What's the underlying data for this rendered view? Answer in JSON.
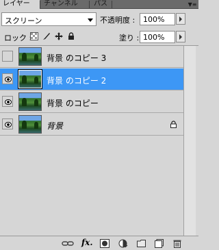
{
  "tabs": [
    {
      "label": "レイヤー",
      "active": true
    },
    {
      "label": "チャンネル",
      "active": false
    },
    {
      "label": "パス",
      "active": false
    }
  ],
  "blend": {
    "mode": "スクリーン"
  },
  "opacity": {
    "label": "不透明度 :",
    "value": "100%"
  },
  "lock": {
    "label": "ロック :"
  },
  "fill": {
    "label": "塗り :",
    "value": "100%"
  },
  "layers": [
    {
      "name": "背景 のコピー 3",
      "visible": false,
      "selected": false,
      "italic": false
    },
    {
      "name": "背景 のコピー 2",
      "visible": true,
      "selected": true,
      "italic": false
    },
    {
      "name": "背景 のコピー",
      "visible": true,
      "selected": false,
      "italic": false
    },
    {
      "name": "背景",
      "visible": true,
      "selected": false,
      "italic": true,
      "locked": true
    }
  ],
  "colors": {
    "selection": "#3d97f5",
    "panel": "#d6d6d6",
    "tabbar": "#6a6a6a"
  },
  "bottom_icons": [
    "link-layers-icon",
    "fx-icon",
    "layer-mask-icon",
    "adjustment-layer-icon",
    "new-group-icon",
    "new-layer-icon",
    "trash-icon"
  ],
  "bottom_fx_label": "fx."
}
